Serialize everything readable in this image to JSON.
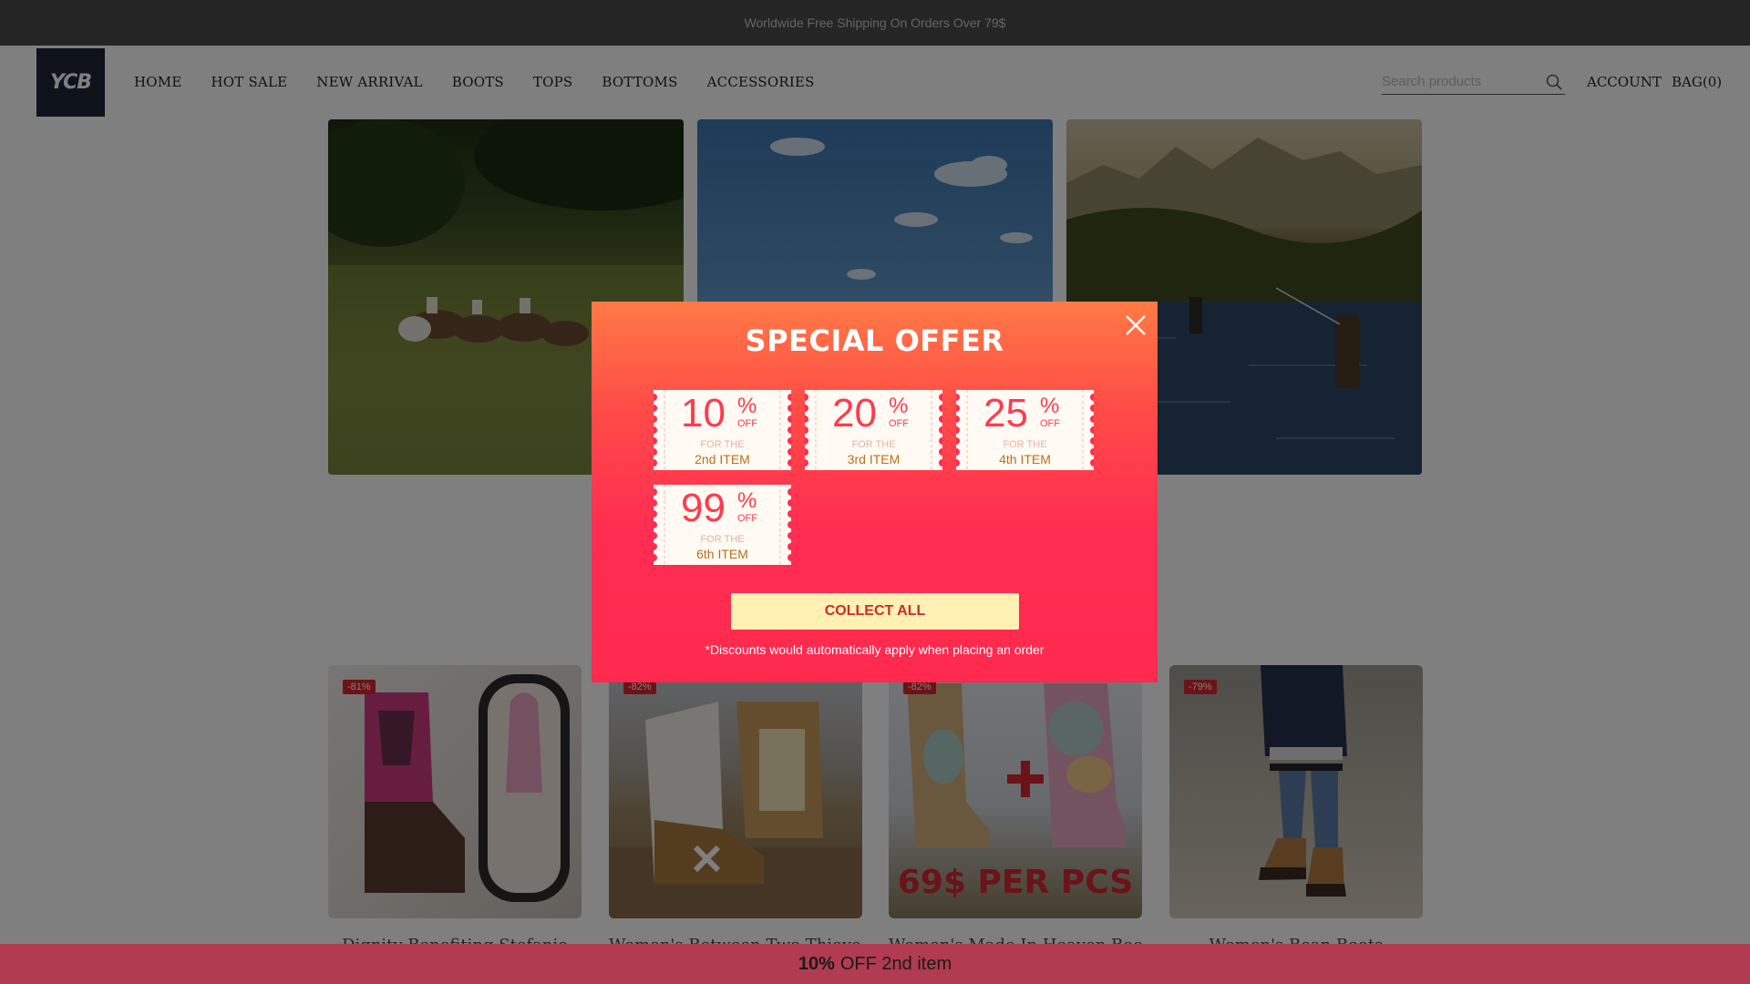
{
  "announcement": "Worldwide Free Shipping On Orders Over 79$",
  "logo": {
    "text": "YCB"
  },
  "nav": {
    "items": [
      "HOME",
      "HOT SALE",
      "NEW ARRIVAL",
      "BOOTS",
      "TOPS",
      "BOTTOMS",
      "ACCESSORIES"
    ],
    "account": "ACCOUNT",
    "bag": "BAG(0)"
  },
  "search": {
    "placeholder": "Search products",
    "icon": "search-icon"
  },
  "products": [
    {
      "discount": "-81%",
      "title": "Dignity Benefiting Stefanie"
    },
    {
      "discount": "-82%",
      "title": "Women's Between Two Thieves"
    },
    {
      "discount": "-82%",
      "title": "Women's Made In Heaven Boots",
      "image_text": "69$ PER PCS"
    },
    {
      "discount": "-79%",
      "title": "Women's Bean Boots"
    }
  ],
  "modal": {
    "title": "SPECIAL OFFER",
    "close_icon": "close-icon",
    "coupons": [
      {
        "value": "10",
        "percent": "%",
        "off": "OFF",
        "for": "FOR THE",
        "item": "2nd ITEM"
      },
      {
        "value": "20",
        "percent": "%",
        "off": "OFF",
        "for": "FOR THE",
        "item": "3rd ITEM"
      },
      {
        "value": "25",
        "percent": "%",
        "off": "OFF",
        "for": "FOR THE",
        "item": "4th ITEM"
      },
      {
        "value": "99",
        "percent": "%",
        "off": "OFF",
        "for": "FOR THE",
        "item": "6th ITEM"
      }
    ],
    "collect_label": "COLLECT ALL",
    "note": "*Discounts would automatically apply when placing an order"
  },
  "bottom_bar": {
    "strong": "10%",
    "rest": "OFF 2nd item"
  },
  "colors": {
    "announcement_bg": "#4a4a4a",
    "logo_bg": "#1c2436",
    "modal_top": "#ff7a45",
    "modal_bottom": "#ff2a4e",
    "coupon_text": "#ff3b4e",
    "collect_bg": "#fff0b3",
    "bottom_bar_bg": "#b13b50"
  }
}
